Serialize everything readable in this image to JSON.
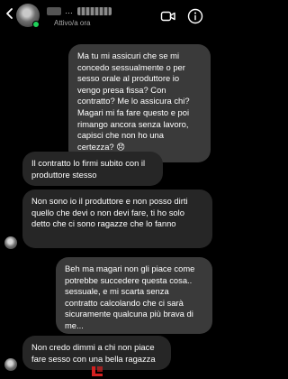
{
  "header": {
    "name_censored": "…",
    "status": "Attivo/a ora",
    "icons": [
      "back-arrow-icon",
      "video-call-icon",
      "info-icon"
    ],
    "online_color": "#1fd15a"
  },
  "messages": [
    {
      "type": "sent",
      "text": "Ma tu mi assicuri che se mi concedo sessualmente o per sesso orale al produttore io vengo presa fissa? Con contratto? Me lo assicura chi? Magari mi fa fare questo e poi rimango ancora senza lavoro, capisci che non ho una certezza? 😞"
    },
    {
      "type": "received",
      "text": "Il contratto lo firmi subito con il produttore stesso"
    },
    {
      "type": "received",
      "text": "Non sono io il produttore e non posso dirti quello che devi o non devi fare, ti ho solo detto che ci sono ragazze che lo fanno"
    },
    {
      "type": "sent",
      "text": "Beh ma magari non gli piace come potrebbe succedere questa cosa.. sessuale, e mi scarta senza contratto calcolando che ci sarà sicuramente qualcuna più brava di me..."
    },
    {
      "type": "received",
      "text": "Non credo dimmi a chi non piace fare sesso con una bella ragazza"
    }
  ],
  "colors": {
    "background": "#000000",
    "sent_bubble": "#3a3a3a",
    "received_bubble": "#262626"
  }
}
